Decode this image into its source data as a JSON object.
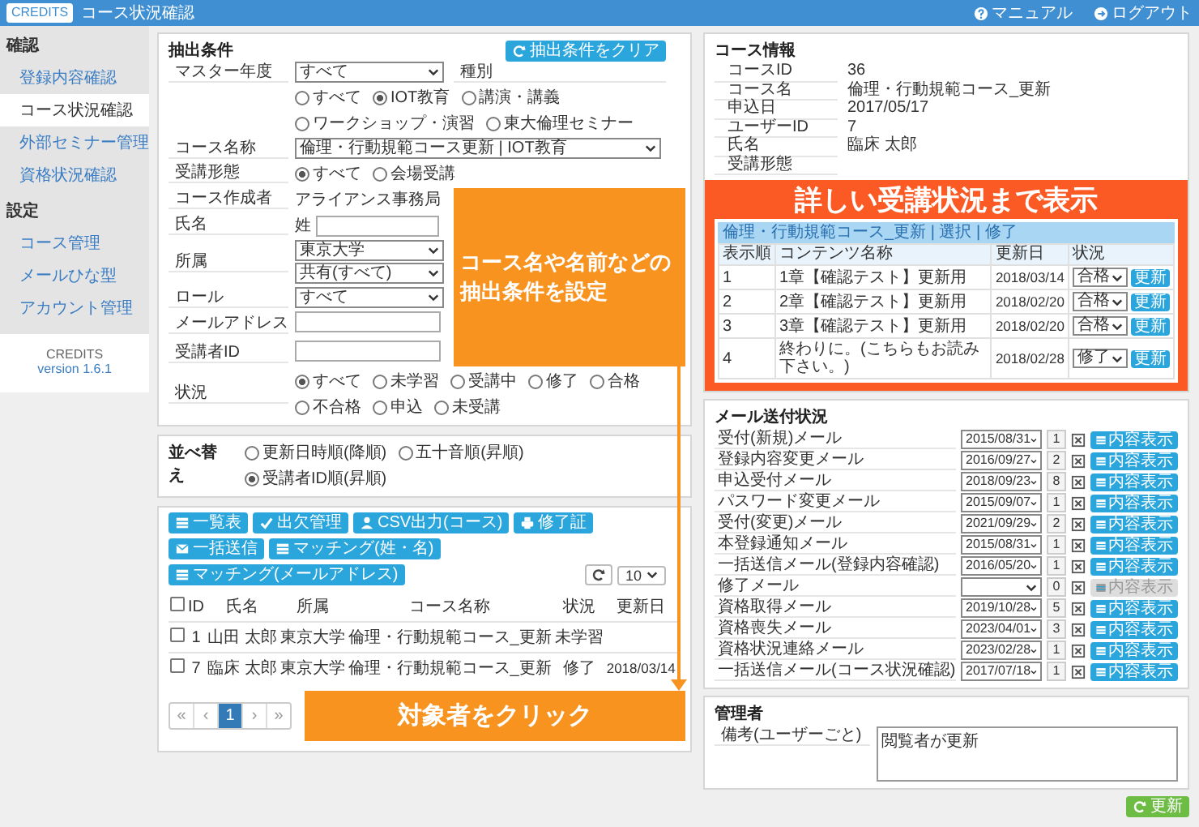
{
  "header": {
    "logo": "CREDITS",
    "title": "コース状況確認",
    "links": [
      {
        "kind": "help",
        "label": "マニュアル"
      },
      {
        "kind": "logout",
        "label": "ログアウト"
      }
    ]
  },
  "sidebar": {
    "sections": [
      {
        "title": "確認",
        "items": [
          {
            "label": "登録内容確認",
            "selected": false
          },
          {
            "label": "コース状況確認",
            "selected": true
          },
          {
            "label": "外部セミナー管理",
            "selected": false
          },
          {
            "label": "資格状況確認",
            "selected": false
          }
        ]
      },
      {
        "title": "設定",
        "items": [
          {
            "label": "コース管理",
            "selected": false
          },
          {
            "label": "メールひな型",
            "selected": false
          },
          {
            "label": "アカウント管理",
            "selected": false
          }
        ]
      }
    ],
    "footer": {
      "product": "CREDITS",
      "version": "version 1.6.1"
    }
  },
  "filter": {
    "title": "抽出条件",
    "clear_button": "抽出条件をクリア",
    "callout": [
      "コース名や名前などの",
      "抽出条件を設定"
    ],
    "fields": [
      {
        "kind": "select",
        "label": "マスター年度",
        "value": "すべて"
      },
      {
        "kind": "radio",
        "label": "種別",
        "options": [
          {
            "label": "すべて",
            "selected": false
          },
          {
            "label": "IOT教育",
            "selected": true
          },
          {
            "label": "講演・講義",
            "selected": false
          },
          {
            "label": "ワークショップ・演習",
            "selected": false
          },
          {
            "label": "東大倫理セミナー",
            "selected": false
          }
        ]
      },
      {
        "kind": "long_select",
        "label": "コース名称",
        "value": "倫理・行動規範コース更新 | IOT教育"
      },
      {
        "kind": "radio",
        "label": "受講形態",
        "options": [
          {
            "label": "すべて",
            "selected": true
          },
          {
            "label": "会場受講",
            "selected": false
          }
        ]
      },
      {
        "kind": "text",
        "label": "コース作成者",
        "value": "アライアンス事務局"
      },
      {
        "kind": "name_input",
        "label": "氏名",
        "prefix": "姓"
      },
      {
        "kind": "select_pair",
        "label": "所属",
        "values": [
          "東京大学",
          "共有(すべて)"
        ]
      },
      {
        "kind": "select",
        "label": "ロール",
        "value": "すべて"
      },
      {
        "kind": "input",
        "label": "メールアドレス"
      },
      {
        "kind": "input",
        "label": "受講者ID"
      },
      {
        "kind": "radio",
        "label": "状況",
        "options": [
          {
            "label": "すべて",
            "selected": true
          },
          {
            "label": "未学習",
            "selected": false
          },
          {
            "label": "受講中",
            "selected": false
          },
          {
            "label": "修了",
            "selected": false
          },
          {
            "label": "合格",
            "selected": false
          },
          {
            "label": "不合格",
            "selected": false
          },
          {
            "label": "申込",
            "selected": false
          },
          {
            "label": "未受講",
            "selected": false
          }
        ]
      }
    ]
  },
  "sort": {
    "title": "並べ替え",
    "options": [
      {
        "label": "更新日時順(降順)",
        "selected": false
      },
      {
        "label": "五十音順(昇順)",
        "selected": false
      },
      {
        "label": "受講者ID順(昇順)",
        "selected": true
      }
    ]
  },
  "results": {
    "toolbar": [
      {
        "kind": "list",
        "label": "一覧表"
      },
      {
        "kind": "check",
        "label": "出欠管理"
      },
      {
        "kind": "user",
        "label": "CSV出力(コース)"
      },
      {
        "kind": "print",
        "label": "修了証"
      },
      {
        "kind": "mail",
        "label": "一括送信"
      },
      {
        "kind": "list",
        "label": "マッチング(姓・名)"
      },
      {
        "kind": "list",
        "label": "マッチング(メールアドレス)"
      }
    ],
    "page_size": "10",
    "all_checked": false,
    "columns": [
      "ID",
      "氏名",
      "所属",
      "コース名称",
      "状況",
      "更新日"
    ],
    "rows": [
      {
        "checked": false,
        "id": "1",
        "name": "山田 太郎",
        "affiliation": "東京大学",
        "course": "倫理・行動規範コース_更新",
        "status": "未学習"
      },
      {
        "checked": false,
        "id": "7",
        "name": "臨床 太郎",
        "affiliation": "東京大学",
        "course": "倫理・行動規範コース_更新",
        "status": "修了",
        "updated": "2018/03/14"
      }
    ],
    "pagination": [
      {
        "label": "«",
        "selected": false
      },
      {
        "label": "‹",
        "selected": false
      },
      {
        "label": "1",
        "selected": true
      },
      {
        "label": "›",
        "selected": false
      },
      {
        "label": "»",
        "selected": false
      }
    ],
    "callout": "対象者をクリック"
  },
  "course_info": {
    "title": "コース情報",
    "rows": [
      {
        "label": "コースID",
        "value": "36"
      },
      {
        "label": "コース名",
        "value": "倫理・行動規範コース_更新"
      },
      {
        "label": "申込日",
        "value": "2017/05/17"
      },
      {
        "label": "ユーザーID",
        "value": "7"
      },
      {
        "label": "氏名",
        "value": "臨床 太郎"
      },
      {
        "label": "受講形態"
      }
    ],
    "callout": {
      "title": "詳しい受講状況まで表示",
      "caption": "倫理・行動規範コース_更新 | 選択 | 修了",
      "columns": [
        "表示順",
        "コンテンツ名称",
        "更新日",
        "状況"
      ],
      "rows": [
        {
          "order": "1",
          "name": "1章【確認テスト】更新用",
          "updated": "2018/03/14",
          "status": "合格",
          "button": "更新"
        },
        {
          "order": "2",
          "name": "2章【確認テスト】更新用",
          "updated": "2018/02/20",
          "status": "合格",
          "button": "更新"
        },
        {
          "order": "3",
          "name": "3章【確認テスト】更新用",
          "updated": "2018/02/20",
          "status": "合格",
          "button": "更新"
        },
        {
          "order": "4",
          "name": "終わりに。(こちらもお読み下さい。)",
          "updated": "2018/02/28",
          "status": "修了",
          "button": "更新"
        }
      ]
    }
  },
  "mail": {
    "title": "メール送付状況",
    "rows": [
      {
        "name": "受付(新規)メール",
        "date": "2015/08/31",
        "count": "1",
        "button": "内容表示",
        "disabled": false
      },
      {
        "name": "登録内容変更メール",
        "date": "2016/09/27",
        "count": "2",
        "button": "内容表示",
        "disabled": false
      },
      {
        "name": "申込受付メール",
        "date": "2018/09/23",
        "count": "8",
        "button": "内容表示",
        "disabled": false
      },
      {
        "name": "パスワード変更メール",
        "date": "2015/09/07",
        "count": "1",
        "button": "内容表示",
        "disabled": false
      },
      {
        "name": "受付(変更)メール",
        "date": "2021/09/29",
        "count": "2",
        "button": "内容表示",
        "disabled": false
      },
      {
        "name": "本登録通知メール",
        "date": "2015/08/31",
        "count": "1",
        "button": "内容表示",
        "disabled": false
      },
      {
        "name": "一括送信メール(登録内容確認)",
        "date": "2016/05/20",
        "count": "1",
        "button": "内容表示",
        "disabled": false
      },
      {
        "name": "修了メール",
        "count": "0",
        "button": "内容表示",
        "disabled": true
      },
      {
        "name": "資格取得メール",
        "date": "2019/10/28",
        "count": "5",
        "button": "内容表示",
        "disabled": false
      },
      {
        "name": "資格喪失メール",
        "date": "2023/04/01",
        "count": "3",
        "button": "内容表示",
        "disabled": false
      },
      {
        "name": "資格状況連絡メール",
        "date": "2023/02/28",
        "count": "1",
        "button": "内容表示",
        "disabled": false
      },
      {
        "name": "一括送信メール(コース状況確認)",
        "date": "2017/07/18",
        "count": "1",
        "button": "内容表示",
        "disabled": false
      }
    ]
  },
  "admin": {
    "title": "管理者",
    "note_label": "備考(ユーザーごと)",
    "note": "閲覧者が更新"
  },
  "save_button": "更新"
}
